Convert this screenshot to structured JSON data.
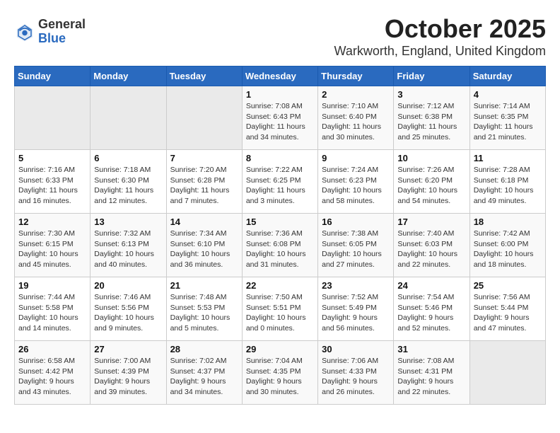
{
  "header": {
    "logo_general": "General",
    "logo_blue": "Blue",
    "month_title": "October 2025",
    "location": "Warkworth, England, United Kingdom"
  },
  "weekdays": [
    "Sunday",
    "Monday",
    "Tuesday",
    "Wednesday",
    "Thursday",
    "Friday",
    "Saturday"
  ],
  "weeks": [
    [
      {
        "day": "",
        "info": ""
      },
      {
        "day": "",
        "info": ""
      },
      {
        "day": "",
        "info": ""
      },
      {
        "day": "1",
        "info": "Sunrise: 7:08 AM\nSunset: 6:43 PM\nDaylight: 11 hours\nand 34 minutes."
      },
      {
        "day": "2",
        "info": "Sunrise: 7:10 AM\nSunset: 6:40 PM\nDaylight: 11 hours\nand 30 minutes."
      },
      {
        "day": "3",
        "info": "Sunrise: 7:12 AM\nSunset: 6:38 PM\nDaylight: 11 hours\nand 25 minutes."
      },
      {
        "day": "4",
        "info": "Sunrise: 7:14 AM\nSunset: 6:35 PM\nDaylight: 11 hours\nand 21 minutes."
      }
    ],
    [
      {
        "day": "5",
        "info": "Sunrise: 7:16 AM\nSunset: 6:33 PM\nDaylight: 11 hours\nand 16 minutes."
      },
      {
        "day": "6",
        "info": "Sunrise: 7:18 AM\nSunset: 6:30 PM\nDaylight: 11 hours\nand 12 minutes."
      },
      {
        "day": "7",
        "info": "Sunrise: 7:20 AM\nSunset: 6:28 PM\nDaylight: 11 hours\nand 7 minutes."
      },
      {
        "day": "8",
        "info": "Sunrise: 7:22 AM\nSunset: 6:25 PM\nDaylight: 11 hours\nand 3 minutes."
      },
      {
        "day": "9",
        "info": "Sunrise: 7:24 AM\nSunset: 6:23 PM\nDaylight: 10 hours\nand 58 minutes."
      },
      {
        "day": "10",
        "info": "Sunrise: 7:26 AM\nSunset: 6:20 PM\nDaylight: 10 hours\nand 54 minutes."
      },
      {
        "day": "11",
        "info": "Sunrise: 7:28 AM\nSunset: 6:18 PM\nDaylight: 10 hours\nand 49 minutes."
      }
    ],
    [
      {
        "day": "12",
        "info": "Sunrise: 7:30 AM\nSunset: 6:15 PM\nDaylight: 10 hours\nand 45 minutes."
      },
      {
        "day": "13",
        "info": "Sunrise: 7:32 AM\nSunset: 6:13 PM\nDaylight: 10 hours\nand 40 minutes."
      },
      {
        "day": "14",
        "info": "Sunrise: 7:34 AM\nSunset: 6:10 PM\nDaylight: 10 hours\nand 36 minutes."
      },
      {
        "day": "15",
        "info": "Sunrise: 7:36 AM\nSunset: 6:08 PM\nDaylight: 10 hours\nand 31 minutes."
      },
      {
        "day": "16",
        "info": "Sunrise: 7:38 AM\nSunset: 6:05 PM\nDaylight: 10 hours\nand 27 minutes."
      },
      {
        "day": "17",
        "info": "Sunrise: 7:40 AM\nSunset: 6:03 PM\nDaylight: 10 hours\nand 22 minutes."
      },
      {
        "day": "18",
        "info": "Sunrise: 7:42 AM\nSunset: 6:00 PM\nDaylight: 10 hours\nand 18 minutes."
      }
    ],
    [
      {
        "day": "19",
        "info": "Sunrise: 7:44 AM\nSunset: 5:58 PM\nDaylight: 10 hours\nand 14 minutes."
      },
      {
        "day": "20",
        "info": "Sunrise: 7:46 AM\nSunset: 5:56 PM\nDaylight: 10 hours\nand 9 minutes."
      },
      {
        "day": "21",
        "info": "Sunrise: 7:48 AM\nSunset: 5:53 PM\nDaylight: 10 hours\nand 5 minutes."
      },
      {
        "day": "22",
        "info": "Sunrise: 7:50 AM\nSunset: 5:51 PM\nDaylight: 10 hours\nand 0 minutes."
      },
      {
        "day": "23",
        "info": "Sunrise: 7:52 AM\nSunset: 5:49 PM\nDaylight: 9 hours\nand 56 minutes."
      },
      {
        "day": "24",
        "info": "Sunrise: 7:54 AM\nSunset: 5:46 PM\nDaylight: 9 hours\nand 52 minutes."
      },
      {
        "day": "25",
        "info": "Sunrise: 7:56 AM\nSunset: 5:44 PM\nDaylight: 9 hours\nand 47 minutes."
      }
    ],
    [
      {
        "day": "26",
        "info": "Sunrise: 6:58 AM\nSunset: 4:42 PM\nDaylight: 9 hours\nand 43 minutes."
      },
      {
        "day": "27",
        "info": "Sunrise: 7:00 AM\nSunset: 4:39 PM\nDaylight: 9 hours\nand 39 minutes."
      },
      {
        "day": "28",
        "info": "Sunrise: 7:02 AM\nSunset: 4:37 PM\nDaylight: 9 hours\nand 34 minutes."
      },
      {
        "day": "29",
        "info": "Sunrise: 7:04 AM\nSunset: 4:35 PM\nDaylight: 9 hours\nand 30 minutes."
      },
      {
        "day": "30",
        "info": "Sunrise: 7:06 AM\nSunset: 4:33 PM\nDaylight: 9 hours\nand 26 minutes."
      },
      {
        "day": "31",
        "info": "Sunrise: 7:08 AM\nSunset: 4:31 PM\nDaylight: 9 hours\nand 22 minutes."
      },
      {
        "day": "",
        "info": ""
      }
    ]
  ]
}
